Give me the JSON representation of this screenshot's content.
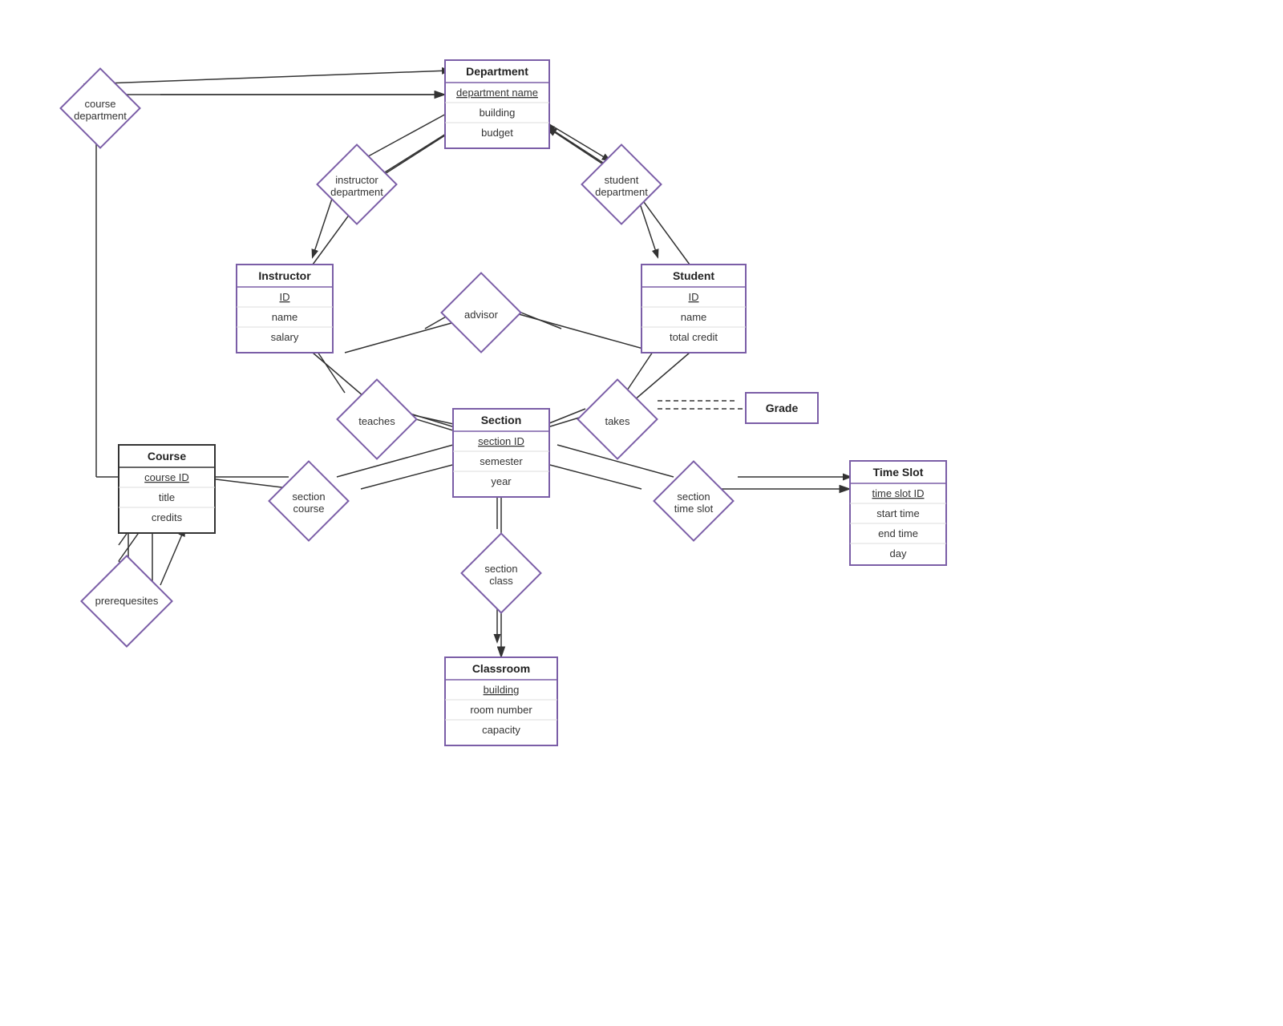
{
  "entities": {
    "department": {
      "title": "Department",
      "attrs": [
        {
          "label": "department name",
          "pk": true
        },
        {
          "label": "building",
          "pk": false
        },
        {
          "label": "budget",
          "pk": false
        }
      ]
    },
    "instructor": {
      "title": "Instructor",
      "attrs": [
        {
          "label": "ID",
          "pk": true
        },
        {
          "label": "name",
          "pk": false
        },
        {
          "label": "salary",
          "pk": false
        }
      ]
    },
    "student": {
      "title": "Student",
      "attrs": [
        {
          "label": "ID",
          "pk": true
        },
        {
          "label": "name",
          "pk": false
        },
        {
          "label": "total credit",
          "pk": false
        }
      ]
    },
    "section": {
      "title": "Section",
      "attrs": [
        {
          "label": "section ID",
          "pk": true
        },
        {
          "label": "semester",
          "pk": false
        },
        {
          "label": "year",
          "pk": false
        }
      ]
    },
    "course": {
      "title": "Course",
      "attrs": [
        {
          "label": "course ID",
          "pk": true
        },
        {
          "label": "title",
          "pk": false
        },
        {
          "label": "credits",
          "pk": false
        }
      ]
    },
    "classroom": {
      "title": "Classroom",
      "attrs": [
        {
          "label": "building",
          "pk": true
        },
        {
          "label": "room number",
          "pk": false
        },
        {
          "label": "capacity",
          "pk": false
        }
      ]
    },
    "timeslot": {
      "title": "Time Slot",
      "attrs": [
        {
          "label": "time slot ID",
          "pk": true
        },
        {
          "label": "start time",
          "pk": false
        },
        {
          "label": "end time",
          "pk": false
        },
        {
          "label": "day",
          "pk": false
        }
      ]
    },
    "grade": {
      "title": "Grade",
      "attrs": []
    }
  },
  "diamonds": {
    "course_department": {
      "label": "course\ndepartment"
    },
    "instructor_department": {
      "label": "instructor\ndepartment"
    },
    "student_department": {
      "label": "student\ndepartment"
    },
    "advisor": {
      "label": "advisor"
    },
    "teaches": {
      "label": "teaches"
    },
    "takes": {
      "label": "takes"
    },
    "section_course": {
      "label": "section\ncourse"
    },
    "section_timeslot": {
      "label": "section\ntime slot"
    },
    "section_class": {
      "label": "section\nclass"
    },
    "prerequesites": {
      "label": "prerequesites"
    }
  }
}
